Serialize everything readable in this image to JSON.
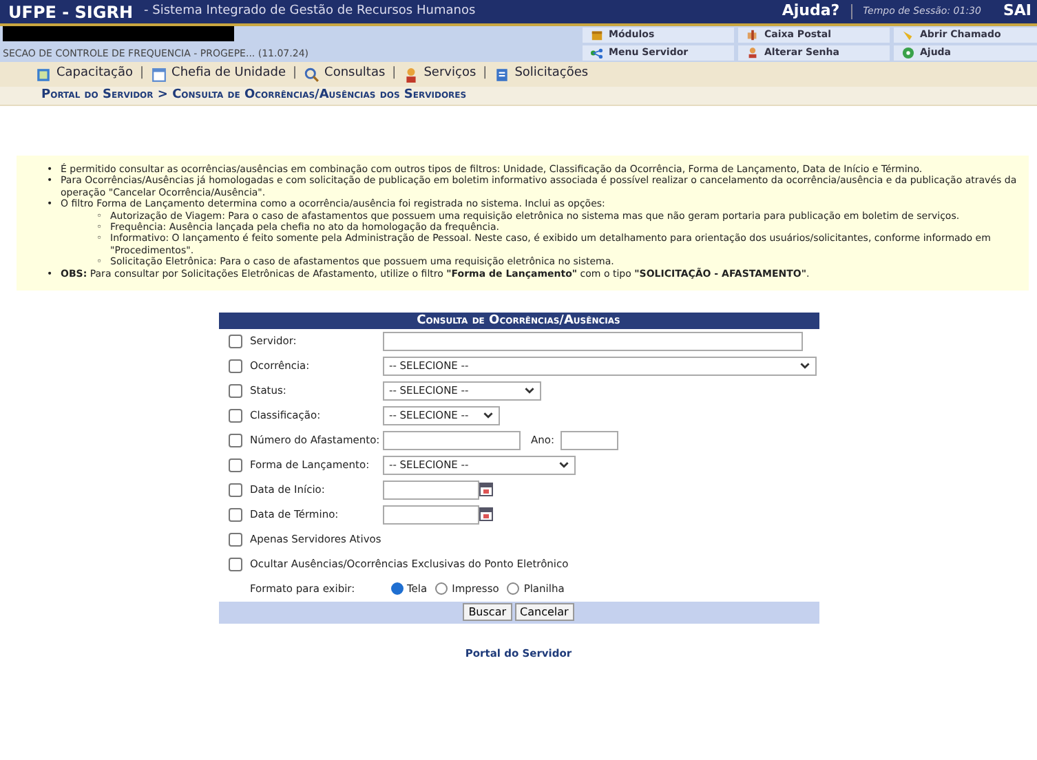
{
  "header": {
    "system": "UFPE - SIGRH",
    "subtitle": "- Sistema Integrado de Gestão de Recursos Humanos",
    "help": "Ajuda?",
    "session": "Tempo de Sessão: 01:30",
    "exit": "SAI"
  },
  "user": {
    "unit": "SECAO DE CONTROLE DE FREQUENCIA - PROGEPE... (11.07.24)"
  },
  "quick_links": [
    "Módulos",
    "Caixa Postal",
    "Abrir Chamado",
    "Menu Servidor",
    "Alterar Senha",
    "Ajuda"
  ],
  "menu": [
    "Capacitação",
    "Chefia de Unidade",
    "Consultas",
    "Serviços",
    "Solicitações"
  ],
  "menu_separator": "|",
  "bullets": {
    "outer": "•",
    "inner": "◦"
  },
  "breadcrumb": "Portal do Servidor > Consulta de Ocorrências/Ausências dos Servidores",
  "notices": [
    {
      "text": "É permitido consultar as ocorrências/ausências em combinação com outros tipos de filtros: Unidade, Classificação da Ocorrência, Forma de Lançamento, Data de Início e Término."
    },
    {
      "text": "Para Ocorrências/Ausências já homologadas e com solicitação de publicação em boletim informativo associada é possível realizar o cancelamento da ocorrência/ausência e da publicação através da operação \"Cancelar Ocorrência/Ausência\"."
    },
    {
      "text": "O filtro Forma de Lançamento determina como a ocorrência/ausência foi registrada no sistema. Inclui as opções:",
      "children": [
        {
          "text": "Autorização de Viagem: Para o caso de afastamentos que possuem uma requisição eletrônica no sistema mas que não geram portaria para publicação em boletim de serviços."
        },
        {
          "text": "Frequência: Ausência lançada pela chefia no ato da homologação da frequência."
        },
        {
          "text": "Informativo: O lançamento é feito somente pela Administração de Pessoal. Neste caso, é exibido um detalhamento para orientação dos usuários/solicitantes, conforme informado em \"Procedimentos\"."
        },
        {
          "text": "Solicitação Eletrônica: Para o caso de afastamentos que possuem uma requisição eletrônica no sistema."
        }
      ]
    },
    {
      "text": "**OBS:** Para consultar por Solicitações Eletrônicas de Afastamento, utilize o filtro **\"Forma de Lançamento\"** com o tipo **\"SOLICITAÇÃO - AFASTAMENTO\"**."
    }
  ],
  "form": {
    "title": "Consulta de Ocorrências/Ausências",
    "rows": [
      {
        "kind": "text",
        "label": "Servidor:",
        "checked": false
      },
      {
        "kind": "select",
        "label": "Ocorrência:",
        "checked": false,
        "value": "-- SELECIONE --"
      },
      {
        "kind": "select",
        "label": "Status:",
        "checked": false,
        "value": "-- SELECIONE --"
      },
      {
        "kind": "select",
        "label": "Classificação:",
        "checked": false,
        "value": "-- SELECIONE --"
      },
      {
        "kind": "pair",
        "label": "Número do Afastamento:",
        "checked": false,
        "label_2": "Ano:"
      },
      {
        "kind": "select",
        "label": "Forma de Lançamento:",
        "checked": false,
        "value": "-- SELECIONE --"
      },
      {
        "kind": "date",
        "label": "Data de Início:",
        "checked": false
      },
      {
        "kind": "date",
        "label": "Data de Término:",
        "checked": false
      },
      {
        "kind": "check",
        "label": "Apenas Servidores Ativos",
        "checked": false
      },
      {
        "kind": "check",
        "label": "Ocultar Ausências/Ocorrências Exclusivas do Ponto Eletrônico",
        "checked": false
      },
      {
        "kind": "radio",
        "label": "Formato para exibir:",
        "options": [
          {
            "label": "Tela",
            "selected": true
          },
          {
            "label": "Impresso",
            "selected": false
          },
          {
            "label": "Planilha",
            "selected": false
          }
        ]
      }
    ],
    "buttons": [
      "Buscar",
      "Cancelar"
    ]
  },
  "footer_link": "Portal do Servidor"
}
